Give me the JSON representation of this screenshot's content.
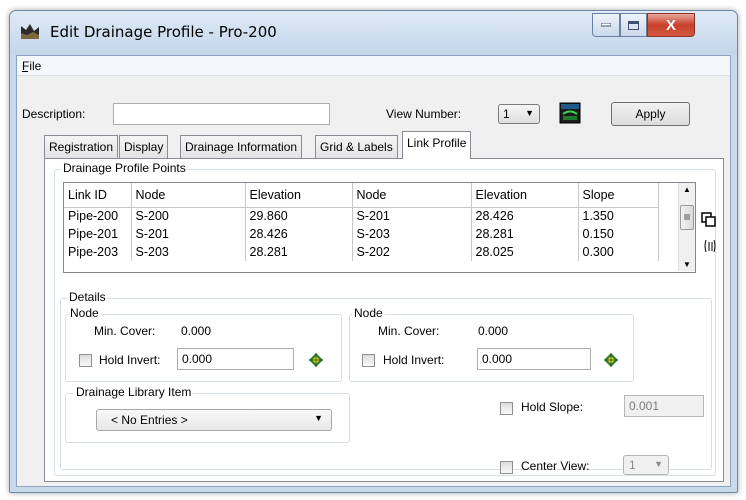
{
  "window": {
    "title": "Edit Drainage Profile - Pro-200",
    "close_glyph": "X"
  },
  "menu": {
    "file_label": "File"
  },
  "top": {
    "description_label": "Description:",
    "description_value": "",
    "view_number_label": "View Number:",
    "view_number_value": "1",
    "apply_label": "Apply"
  },
  "tabs": [
    {
      "label": "Registration"
    },
    {
      "label": "Display"
    },
    {
      "label": "Drainage Information"
    },
    {
      "label": "Grid & Labels"
    },
    {
      "label": "Link Profile"
    }
  ],
  "profile_points": {
    "title": "Drainage Profile Points",
    "columns": [
      "Link ID",
      "Node",
      "Elevation",
      "Node",
      "Elevation",
      "Slope"
    ],
    "rows": [
      [
        "Pipe-200",
        "S-200",
        "29.860",
        "S-201",
        "28.426",
        "1.350"
      ],
      [
        "Pipe-201",
        "S-201",
        "28.426",
        "S-203",
        "28.281",
        "0.150"
      ],
      [
        "Pipe-203",
        "S-203",
        "28.281",
        "S-202",
        "28.025",
        "0.300"
      ]
    ]
  },
  "details": {
    "title": "Details",
    "node_left": {
      "title": "Node",
      "min_cover_label": "Min. Cover:",
      "min_cover_value": "0.000",
      "hold_invert_label": "Hold Invert:",
      "hold_invert_value": "0.000"
    },
    "node_right": {
      "title": "Node",
      "min_cover_label": "Min. Cover:",
      "min_cover_value": "0.000",
      "hold_invert_label": "Hold Invert:",
      "hold_invert_value": "0.000"
    },
    "library": {
      "title": "Drainage Library Item",
      "value": "< No Entries >"
    },
    "hold_slope_label": "Hold Slope:",
    "hold_slope_value": "0.001",
    "center_view_label": "Center View:",
    "center_view_value": "1"
  },
  "icons": {
    "window": "profile-app-icon",
    "view": "view-window-icon",
    "copy": "copy-icon",
    "sort": "sort-icon",
    "pick": "target-locate-icon"
  },
  "colors": {
    "titlebar": "#c9d9ec",
    "close": "#c7402c",
    "panel": "#ffffff"
  }
}
